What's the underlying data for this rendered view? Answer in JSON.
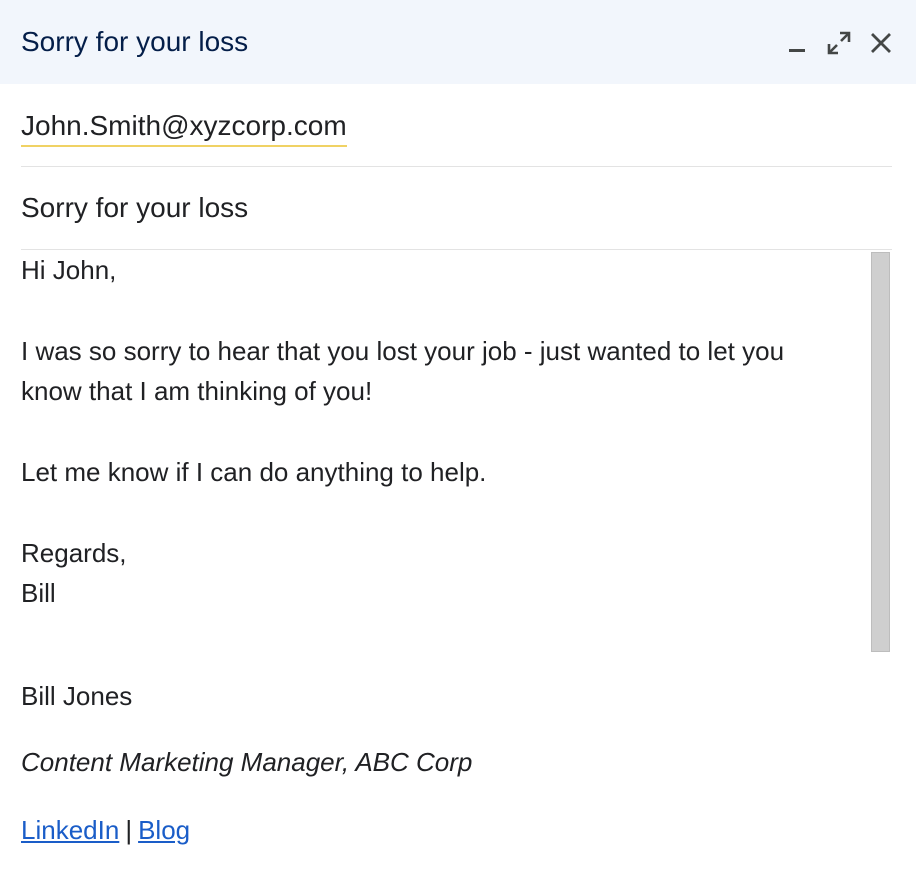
{
  "window": {
    "title": "Sorry for your loss",
    "controls": {
      "minimize_icon": "minimize-icon",
      "popout_icon": "popout-icon",
      "close_icon": "close-icon"
    }
  },
  "recipients": {
    "to": "John.Smith@xyzcorp.com"
  },
  "subject": "Sorry for your loss",
  "body": {
    "greeting": "Hi John,",
    "line1": "I was so sorry to hear that you lost your job - just wanted to let you",
    "line2": "know that I am thinking of you!",
    "line3": "Let me know if I can do anything to help.",
    "closing": "Regards,",
    "sender": "Bill"
  },
  "signature": {
    "name": "Bill Jones",
    "title": "Content Marketing Manager, ABC Corp",
    "links": {
      "linkedin": "LinkedIn",
      "separator": "|",
      "blog": "Blog"
    }
  },
  "colors": {
    "title_bar_bg": "#f2f6fc",
    "title_text": "#041e49",
    "link": "#1a5dc8",
    "recipient_underline": "#f0d264"
  }
}
